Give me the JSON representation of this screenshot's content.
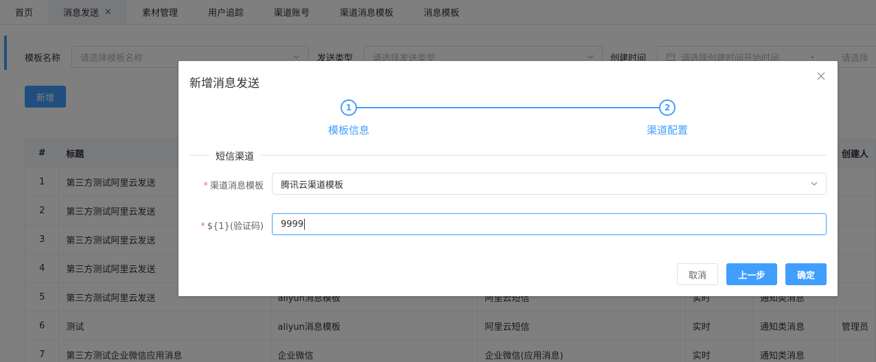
{
  "tabs": [
    {
      "label": "首页"
    },
    {
      "label": "消息发送"
    },
    {
      "label": "素材管理"
    },
    {
      "label": "用户追踪"
    },
    {
      "label": "渠道账号"
    },
    {
      "label": "渠道消息模板"
    },
    {
      "label": "消息模板"
    }
  ],
  "tab_close_glyph": "×",
  "filters": {
    "template_label": "模板名称",
    "template_placeholder": "请选择模板名称",
    "send_type_label": "发送类型",
    "send_type_placeholder": "请选择发送类型",
    "create_time_label": "创建时间",
    "start_placeholder": "请选择创建时间开始时间",
    "range_sep": "-",
    "end_placeholder": "请选择"
  },
  "add_button": "新增",
  "table": {
    "headers": [
      "#",
      "标题",
      "",
      "",
      "",
      "",
      "创建人"
    ],
    "rows": [
      [
        "1",
        "第三方测试阿里云发送",
        "",
        "",
        "",
        "",
        ""
      ],
      [
        "2",
        "第三方测试阿里云发送",
        "",
        "",
        "",
        "",
        ""
      ],
      [
        "3",
        "第三方测试阿里云发送",
        "",
        "",
        "",
        "",
        ""
      ],
      [
        "4",
        "第三方测试阿里云发送",
        "",
        "",
        "",
        "",
        ""
      ],
      [
        "5",
        "第三方测试阿里云发送",
        "aliyun消息模板",
        "阿里云短信",
        "实时",
        "通知类消息",
        ""
      ],
      [
        "6",
        "测试",
        "aliyun消息模板",
        "阿里云短信",
        "实时",
        "通知类消息",
        "管理员"
      ],
      [
        "7",
        "第三方测试企业微信应用消息",
        "企业微信",
        "企业微信(应用消息)",
        "实时",
        "通知类消息",
        ""
      ]
    ]
  },
  "dialog": {
    "title": "新增消息发送",
    "steps": [
      {
        "number": "1",
        "title": "模板信息"
      },
      {
        "number": "2",
        "title": "渠道配置"
      }
    ],
    "section_title": "短信渠道",
    "fields": {
      "channel_template_label": "渠道消息模板",
      "channel_template_value": "腾讯云渠道模板",
      "code_label": "${1}(验证码)",
      "code_value": "9999"
    },
    "buttons": {
      "cancel": "取消",
      "prev": "上一步",
      "confirm": "确定"
    }
  },
  "colors": {
    "primary": "#409eff",
    "required": "#f56c6c"
  },
  "icons": {
    "tab_close": "close-icon",
    "select_arrow": "chevron-down-icon",
    "calendar": "calendar-icon",
    "dialog_close": "close-icon"
  }
}
